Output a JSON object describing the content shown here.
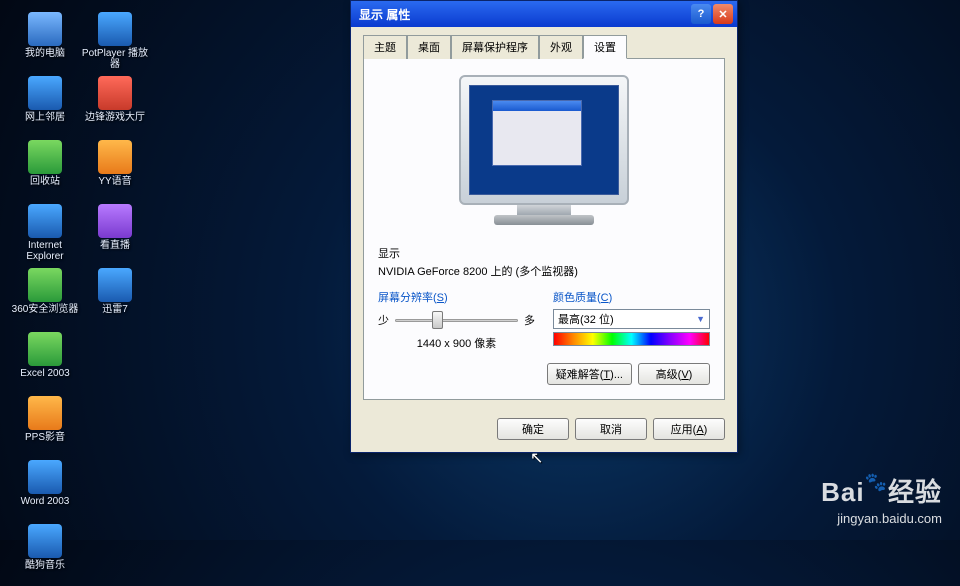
{
  "desktop": {
    "col1": [
      {
        "label": "我的电脑",
        "cls": "ico-pc"
      },
      {
        "label": "网上邻居",
        "cls": "ico-blue"
      },
      {
        "label": "回收站",
        "cls": "ico-green"
      },
      {
        "label": "Internet Explorer",
        "cls": "ico-blue"
      },
      {
        "label": "360安全浏览器",
        "cls": "ico-green"
      },
      {
        "label": "Excel 2003",
        "cls": "ico-green"
      },
      {
        "label": "PPS影音",
        "cls": "ico-orange"
      },
      {
        "label": "Word 2003",
        "cls": "ico-blue"
      },
      {
        "label": "酷狗音乐",
        "cls": "ico-blue"
      }
    ],
    "col2": [
      {
        "label": "PotPlayer 播放器",
        "cls": "ico-blue"
      },
      {
        "label": "边锋游戏大厅",
        "cls": "ico-red"
      },
      {
        "label": "YY语音",
        "cls": "ico-orange"
      },
      {
        "label": "看直播",
        "cls": "ico-purple"
      },
      {
        "label": "迅雷7",
        "cls": "ico-blue"
      }
    ]
  },
  "dialog": {
    "title": "显示 属性",
    "tabs": {
      "theme": "主题",
      "desktop": "桌面",
      "screensaver": "屏幕保护程序",
      "appearance": "外观",
      "settings": "设置"
    },
    "display_label": "显示",
    "display_info": "NVIDIA GeForce 8200 上的 (多个监视器)",
    "resolution": {
      "title_pre": "屏幕分辨率(",
      "title_key": "S",
      "title_post": ")",
      "less": "少",
      "more": "多",
      "value": "1440 x 900 像素"
    },
    "color": {
      "title_pre": "颜色质量(",
      "title_key": "C",
      "title_post": ")",
      "selected": "最高(32 位)"
    },
    "buttons": {
      "troubleshoot_pre": "疑难解答(",
      "troubleshoot_key": "T",
      "troubleshoot_post": ")...",
      "advanced_pre": "高级(",
      "advanced_key": "V",
      "advanced_post": ")",
      "ok": "确定",
      "cancel": "取消",
      "apply_pre": "应用(",
      "apply_key": "A",
      "apply_post": ")"
    }
  },
  "watermark": {
    "brand_pre": "Bai",
    "brand_post": "经验",
    "url": "jingyan.baidu.com"
  }
}
